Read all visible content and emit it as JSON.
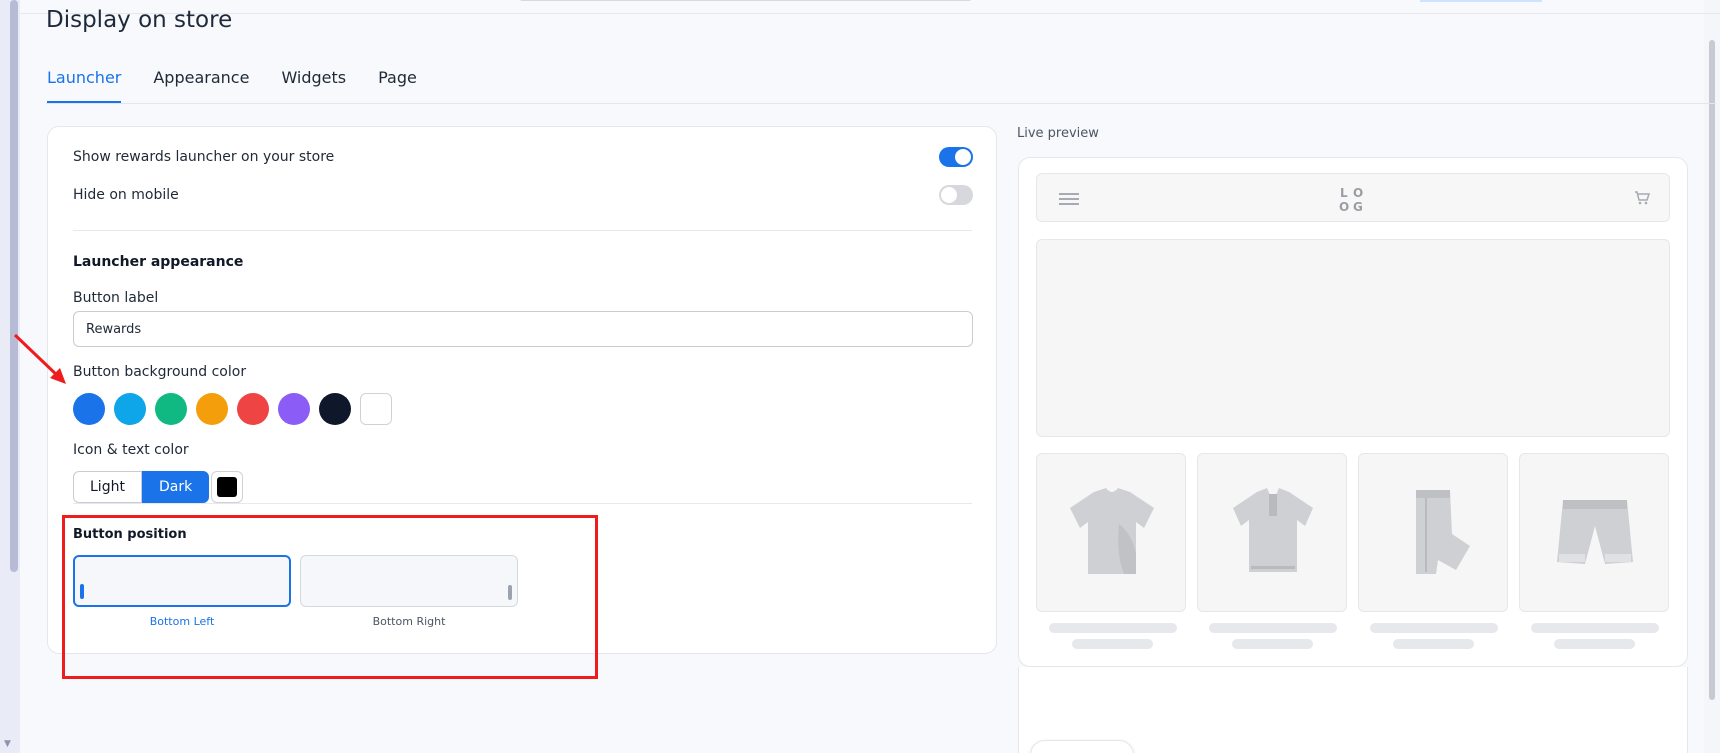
{
  "page": {
    "title": "Display on store"
  },
  "tabs": [
    {
      "label": "Launcher",
      "active": true
    },
    {
      "label": "Appearance",
      "active": false
    },
    {
      "label": "Widgets",
      "active": false
    },
    {
      "label": "Page",
      "active": false
    }
  ],
  "settings": {
    "show_launcher_label": "Show rewards launcher on your store",
    "show_launcher_on": true,
    "hide_mobile_label": "Hide on mobile",
    "hide_mobile_on": false,
    "launcher_appearance_title": "Launcher appearance",
    "button_label_label": "Button label",
    "button_label_value": "Rewards",
    "bg_color_label": "Button background color",
    "bg_colors": [
      "#1a73e8",
      "#0ea5e9",
      "#10b981",
      "#f59e0b",
      "#ef4444",
      "#8b5cf6",
      "#0f172a",
      "#ffffff"
    ],
    "icon_text_color_label": "Icon & text color",
    "icon_text_options": [
      "Light",
      "Dark"
    ],
    "icon_text_selected": "Dark",
    "icon_text_custom_color": "#000000",
    "button_position_label": "Button position",
    "positions": [
      {
        "label": "Bottom Left",
        "selected": true
      },
      {
        "label": "Bottom Right",
        "selected": false
      }
    ]
  },
  "preview": {
    "label": "Live preview",
    "logo_text": "LO OG",
    "products": [
      "t-shirt-icon",
      "polo-shirt-icon",
      "jeans-icon",
      "shorts-icon"
    ]
  },
  "colors": {
    "accent": "#1a73e8",
    "annotation": "#ee1c1c"
  }
}
